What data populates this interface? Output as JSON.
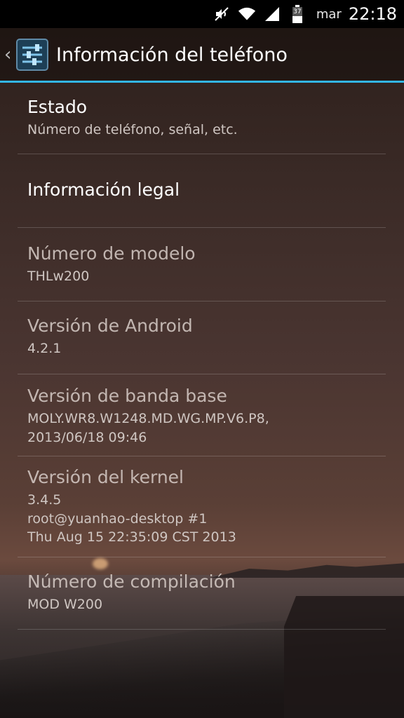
{
  "status_bar": {
    "carrier": "mar",
    "time": "22:18",
    "battery": "37"
  },
  "action_bar": {
    "title": "Información del teléfono"
  },
  "items": [
    {
      "title": "Estado",
      "summary": "Número de teléfono, señal, etc."
    },
    {
      "title": "Información legal",
      "summary": ""
    },
    {
      "title": "Número de modelo",
      "summary": "THLw200"
    },
    {
      "title": "Versión de Android",
      "summary": "4.2.1"
    },
    {
      "title": "Versión de banda base",
      "summary": "MOLY.WR8.W1248.MD.WG.MP.V6.P8,\n2013/06/18 09:46"
    },
    {
      "title": "Versión del kernel",
      "summary": "3.4.5\nroot@yuanhao-desktop #1\nThu Aug 15 22:35:09 CST 2013"
    },
    {
      "title": "Número de compilación",
      "summary": "MOD W200"
    }
  ],
  "colors": {
    "accent": "#33b5e5",
    "status_bar_bg": "#000000"
  },
  "icons": [
    "mute-icon",
    "wifi-icon",
    "signal-icon",
    "battery-icon",
    "back-chevron-icon",
    "settings-sliders-icon"
  ]
}
